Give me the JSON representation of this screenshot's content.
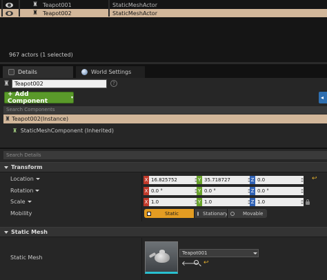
{
  "outliner": {
    "rows": [
      {
        "name": "Teapot001",
        "type": "StaticMeshActor",
        "selected": false
      },
      {
        "name": "Teapot002",
        "type": "StaticMeshActor",
        "selected": true
      }
    ],
    "actor_count": "967 actors (1 selected)"
  },
  "tabs": {
    "details": "Details",
    "world_settings": "World Settings"
  },
  "details": {
    "actor_name": "Teapot002",
    "help": "?",
    "add_component": "+ Add Component",
    "search_components_placeholder": "Search Components",
    "instance_label": "Teapot002(Instance)",
    "component_label": "StaticMeshComponent (Inherited)",
    "search_details_placeholder": "Search Details"
  },
  "transform": {
    "title": "Transform",
    "location": {
      "label": "Location",
      "x": "16.825752",
      "y": "35.718727",
      "z": "0.0"
    },
    "rotation": {
      "label": "Rotation",
      "x": "0.0 °",
      "y": "0.0 °",
      "z": "0.0 °"
    },
    "scale": {
      "label": "Scale",
      "x": "1.0",
      "y": "1.0",
      "z": "1.0"
    },
    "mobility": {
      "label": "Mobility",
      "options": [
        "Static",
        "Stationary",
        "Movable"
      ],
      "selected": "Static"
    }
  },
  "static_mesh": {
    "title": "Static Mesh",
    "label": "Static Mesh",
    "asset": "Teapot001"
  },
  "axis_letters": {
    "x": "X",
    "y": "Y",
    "z": "Z"
  },
  "colors": {
    "selection": "#d2b79a",
    "add_component": "#5a9a2a",
    "mobility_active": "#e39c22",
    "axis_x": "#c03a2b",
    "axis_y": "#69a22b",
    "axis_z": "#3263b5"
  },
  "icons": {
    "visibility": "eye-icon",
    "actor": "static-mesh-actor-icon",
    "reset": "reset-to-default-icon",
    "lock": "lock-icon",
    "browse": "browse-search-icon",
    "use_selected": "use-selected-arrow-icon"
  }
}
